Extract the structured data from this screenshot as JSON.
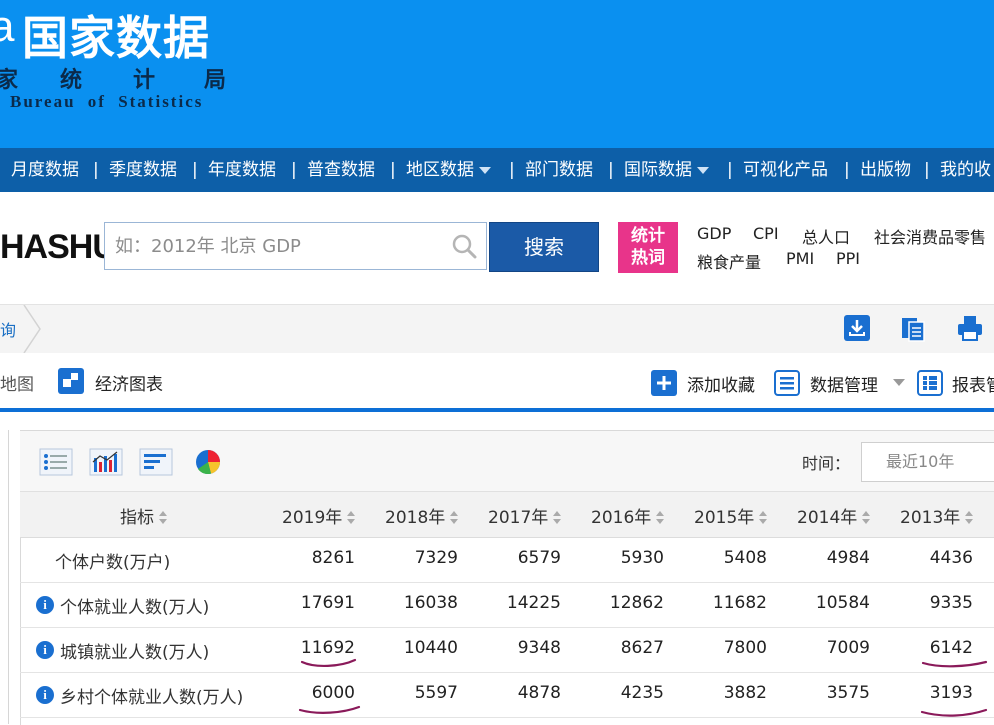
{
  "header": {
    "logo_letter": "a",
    "logo_title": "国家数据",
    "logo_sub_chars": [
      "家",
      "统",
      "计",
      "局"
    ],
    "logo_en": "Bureau of Statistics"
  },
  "nav": {
    "items": [
      {
        "label": "月度数据",
        "dropdown": false
      },
      {
        "label": "季度数据",
        "dropdown": false
      },
      {
        "label": "年度数据",
        "dropdown": false
      },
      {
        "label": "普查数据",
        "dropdown": false
      },
      {
        "label": "地区数据",
        "dropdown": true
      },
      {
        "label": "部门数据",
        "dropdown": false
      },
      {
        "label": "国际数据",
        "dropdown": true
      },
      {
        "label": "可视化产品",
        "dropdown": false
      },
      {
        "label": "出版物",
        "dropdown": false
      },
      {
        "label": "我的收",
        "dropdown": false
      }
    ],
    "separator": "|"
  },
  "search": {
    "brand": "HASHU",
    "placeholder": "如：2012年 北京 GDP",
    "button": "搜索"
  },
  "hot": {
    "badge_line1": "统计",
    "badge_line2": "热词",
    "words_row1": [
      "GDP",
      "CPI",
      "总人口",
      "社会消费品零售"
    ],
    "words_row2": [
      "粮食产量",
      "PMI",
      "PPI"
    ]
  },
  "breadcrumb": {
    "text": "询"
  },
  "tabs": {
    "map": "地图",
    "chart": "经济图表"
  },
  "actions": {
    "favorite": "添加收藏",
    "data_manage": "数据管理",
    "report": "报表管"
  },
  "table": {
    "time_label": "时间：",
    "time_value": "最近10年",
    "header_indicator": "指标",
    "years": [
      "2019年",
      "2018年",
      "2017年",
      "2016年",
      "2015年",
      "2014年",
      "2013年"
    ],
    "rows": [
      {
        "label": "个体户数(万户)",
        "info": false,
        "values": [
          "8261",
          "7329",
          "6579",
          "5930",
          "5408",
          "4984",
          "4436"
        ]
      },
      {
        "label": "个体就业人数(万人)",
        "info": true,
        "values": [
          "17691",
          "16038",
          "14225",
          "12862",
          "11682",
          "10584",
          "9335"
        ]
      },
      {
        "label": "城镇就业人数(万人)",
        "info": true,
        "values": [
          "11692",
          "10440",
          "9348",
          "8627",
          "7800",
          "7009",
          "6142"
        ]
      },
      {
        "label": "乡村个体就业人数(万人)",
        "info": true,
        "values": [
          "6000",
          "5597",
          "4878",
          "4235",
          "3882",
          "3575",
          "3193"
        ]
      }
    ]
  },
  "colors": {
    "banner": "#0a90f0",
    "nav": "#0d5fa8",
    "accent": "#1b5aa7",
    "hot_badge": "#e8348a",
    "annotation": "#8a1a5a"
  }
}
